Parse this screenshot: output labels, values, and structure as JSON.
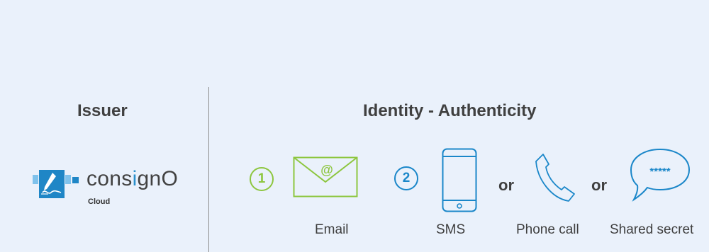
{
  "issuer": {
    "heading": "Issuer",
    "brand_prefix": "cons",
    "brand_accent": "i",
    "brand_suffix": "gnO",
    "brand_sub": "Cloud"
  },
  "identity": {
    "heading": "Identity - Authenticity",
    "step1_number": "1",
    "step2_number": "2",
    "or_label": "or",
    "email_at": "@",
    "secret_mask": "*****",
    "captions": {
      "email": "Email",
      "sms": "SMS",
      "phone": "Phone call",
      "secret": "Shared secret"
    }
  },
  "colors": {
    "background": "#eaf1fb",
    "green": "#8dc63f",
    "blue": "#1b87c9",
    "text": "#3f3f3f"
  },
  "icons": [
    "signature-logo-icon",
    "email-envelope-icon",
    "smartphone-icon",
    "phone-handset-icon",
    "speech-bubble-icon"
  ]
}
